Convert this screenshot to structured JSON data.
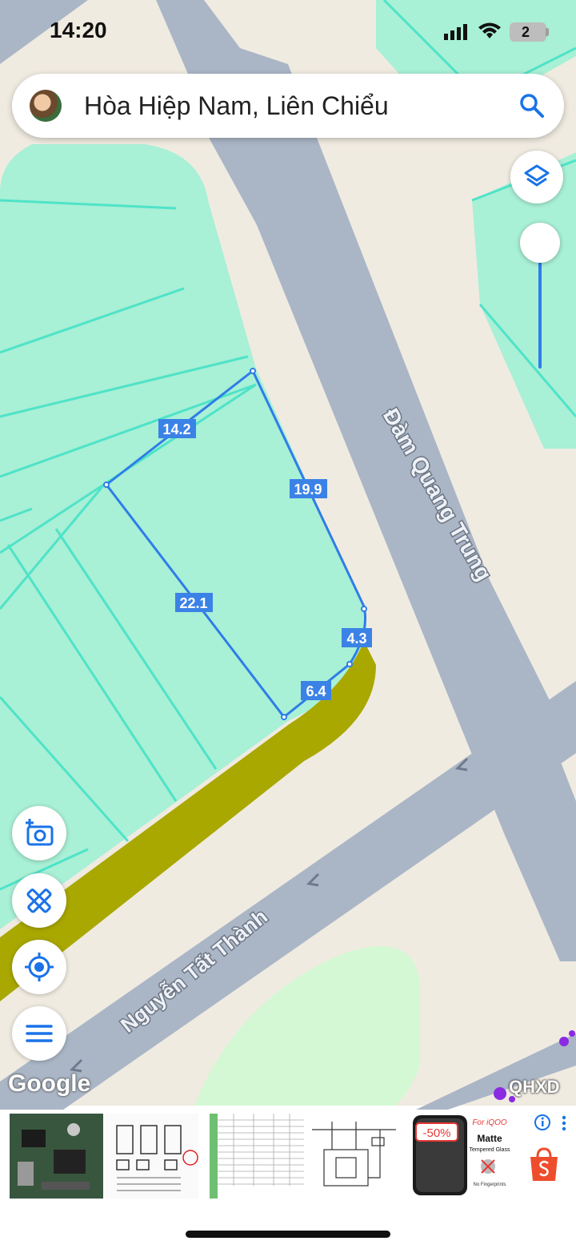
{
  "status_bar": {
    "time": "14:20",
    "battery": "2"
  },
  "search": {
    "query": "Hòa Hiệp Nam, Liên Chiểu"
  },
  "map": {
    "streets": [
      "Đàm Quang Trung",
      "Nguyễn Tất Thành"
    ],
    "measurements": [
      "14.2",
      "19.9",
      "22.1",
      "4.3",
      "6.4"
    ],
    "attribution": "Google",
    "overlay_label": "QHXD"
  },
  "ad": {
    "discount": "-50%",
    "brand_text": "For iQOO",
    "product_title": "Matte",
    "product_sub": "Tempered Glass",
    "product_note": "No Fingerprints"
  }
}
